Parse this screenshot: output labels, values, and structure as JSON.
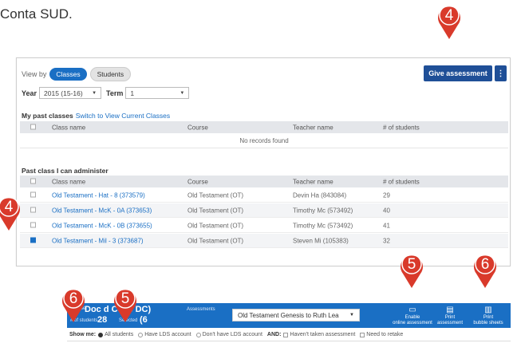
{
  "intro": "Conta SUD.",
  "view_by": {
    "label": "View by",
    "options": [
      "Classes",
      "Students"
    ]
  },
  "buttons": {
    "give_assessment": "Give assessment",
    "more": "⋮"
  },
  "filters": {
    "year_label": "Year",
    "year_value": "2015 (15-16)",
    "term_label": "Term",
    "term_value": "1"
  },
  "past_classes": {
    "title": "My past classes",
    "switch_link": "Switch to View Current Classes",
    "columns": [
      "Class name",
      "Course",
      "Teacher name",
      "# of students"
    ],
    "empty": "No records found"
  },
  "admin_classes": {
    "title": "Past class I can administer",
    "columns": [
      "Class name",
      "Course",
      "Teacher name",
      "# of students"
    ],
    "rows": [
      {
        "name": "Old Testament - Hat - 8 (373579)",
        "course": "Old Testament (OT)",
        "teacher": "Devin Ha (843084)",
        "count": "29",
        "checked": false
      },
      {
        "name": "Old Testament - McK - 0A (373653)",
        "course": "Old Testament (OT)",
        "teacher": "Timothy Mc (573492)",
        "count": "40",
        "checked": false
      },
      {
        "name": "Old Testament - McK - 0B (373655)",
        "course": "Old Testament (OT)",
        "teacher": "Timothy Mc (573492)",
        "count": "41",
        "checked": false
      },
      {
        "name": "Old Testament - Mil - 3 (373687)",
        "course": "Old Testament (OT)",
        "teacher": "Steven Mi (105383)",
        "count": "32",
        "checked": true
      }
    ]
  },
  "bottom_bar": {
    "course_label": "Course",
    "course_value": "Doc      d Cove    DC)",
    "students_label": "# of students",
    "students_value": "28",
    "selected_label": "Selected",
    "selected_value": "(6",
    "assessments_label": "Assessments",
    "assessment_value": "Old Testament Genesis to Ruth Lea",
    "actions": [
      {
        "icon": "▭",
        "label": "Enable",
        "sublabel": "online assessment"
      },
      {
        "icon": "▤",
        "label": "Print",
        "sublabel": "assessment"
      },
      {
        "icon": "▥",
        "label": "Print",
        "sublabel": "bubble sheets"
      }
    ]
  },
  "show_me": {
    "label": "Show me:",
    "radios": [
      "All students",
      "Have LDS account",
      "Don't have LDS account"
    ],
    "and_label": "AND:",
    "checks": [
      "Haven't taken assessment",
      "Need to retake"
    ]
  },
  "markers": [
    "4",
    "4",
    "5",
    "6",
    "5",
    "6"
  ],
  "colors": {
    "accent": "#1a6fc4",
    "button_dark": "#1f4f97",
    "marker": "#d93a2b"
  }
}
